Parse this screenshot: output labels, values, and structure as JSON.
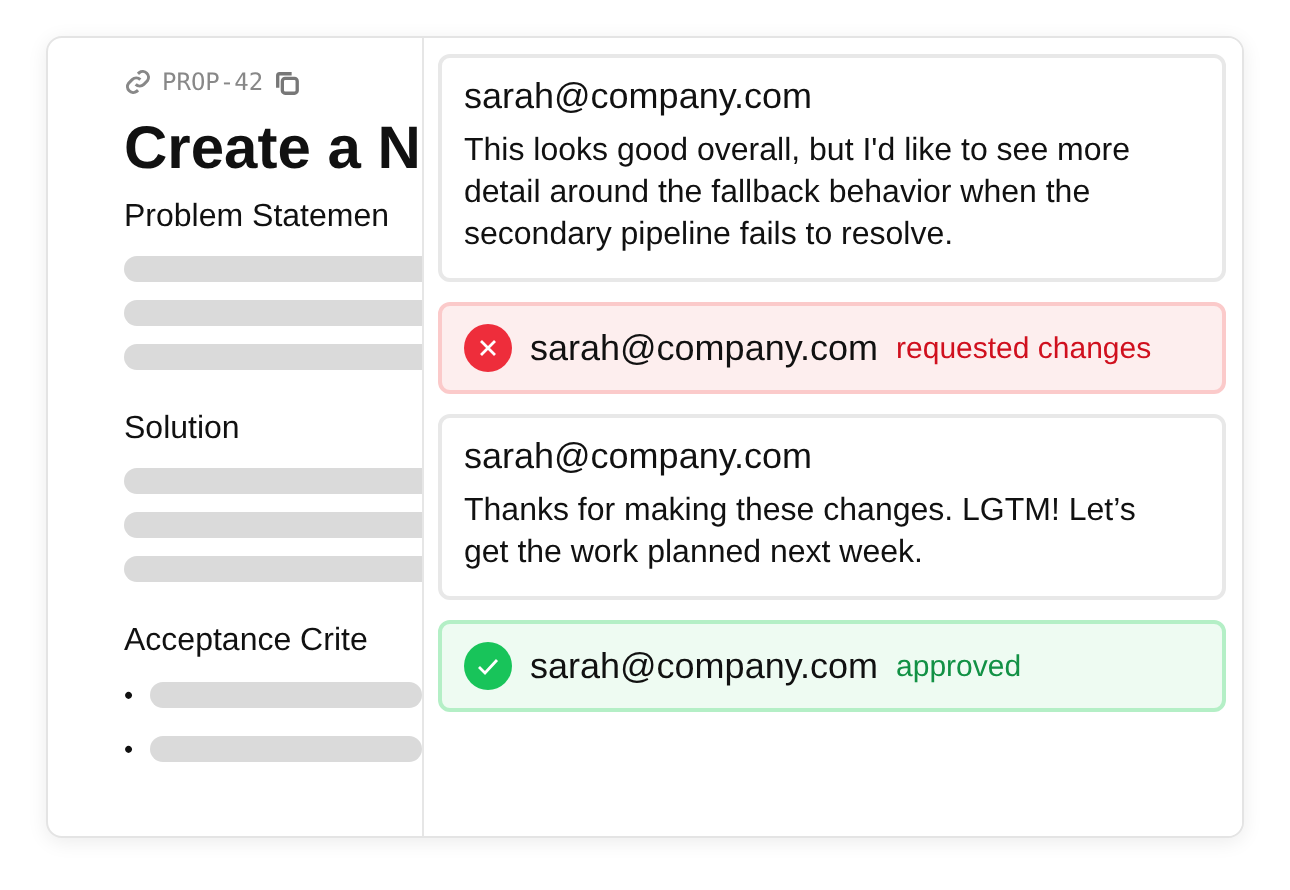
{
  "document": {
    "ticket_id": "PROP-42",
    "title": "Create a N",
    "sections": [
      {
        "heading": "Problem Statemen",
        "kind": "lines"
      },
      {
        "heading": "Solution",
        "kind": "lines"
      },
      {
        "heading": "Acceptance Crite",
        "kind": "bullets",
        "bullets": [
          "•",
          "•"
        ]
      }
    ]
  },
  "activity": [
    {
      "kind": "comment",
      "author": "sarah@company.com",
      "text": "This looks good overall, but I'd like to see more detail around the fallback behavior when the secondary pipeline fails to resolve."
    },
    {
      "kind": "review",
      "author": "sarah@company.com",
      "approved": false,
      "label": "requested changes"
    },
    {
      "kind": "comment",
      "author": "sarah@company.com",
      "text": "Thanks for making these changes. LGTM! Let’s get the work planned next week."
    },
    {
      "kind": "review",
      "author": "sarah@company.com",
      "approved": true,
      "label": "approved"
    }
  ]
}
